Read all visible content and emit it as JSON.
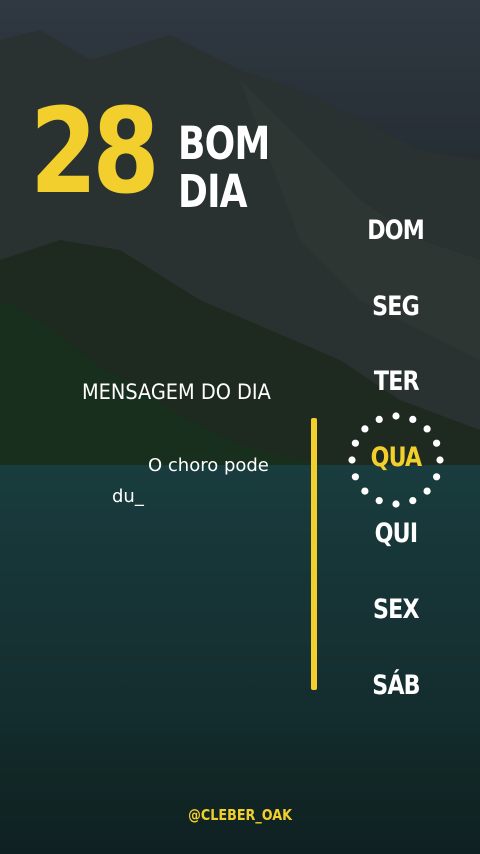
{
  "header": {
    "day_number": "28",
    "greeting_line1": "BOM",
    "greeting_line2": "DIA"
  },
  "message": {
    "title": "MENSAGEM DO DIA",
    "text": "O choro pode du_"
  },
  "weekdays": {
    "items": [
      "DOM",
      "SEG",
      "TER",
      "QUA",
      "QUI",
      "SEX",
      "SÁB"
    ],
    "selected": "QUA"
  },
  "footer": {
    "handle": "@CLEBER_OAK"
  },
  "colors": {
    "accent": "#f2cf2c",
    "text": "#ffffff"
  }
}
